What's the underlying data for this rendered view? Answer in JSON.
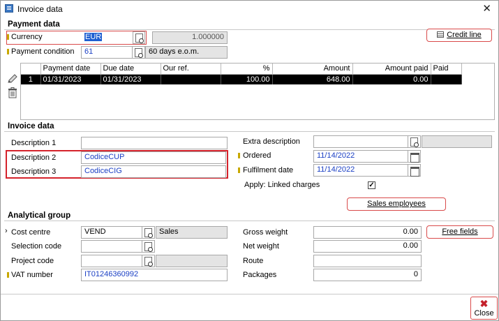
{
  "window": {
    "title": "Invoice data",
    "close_symbol": "✕"
  },
  "payment_data": {
    "section_title": "Payment data",
    "currency_label": "Currency",
    "currency_value": "EUR",
    "exchange_rate": "1.000000",
    "credit_line_label": "Credit line",
    "payment_condition_label": "Payment condition",
    "payment_condition_code": "61",
    "payment_condition_desc": "60 days e.o.m."
  },
  "payments_grid": {
    "columns": [
      "",
      "Payment date",
      "Due date",
      "Our ref.",
      "%",
      "Amount",
      "Amount paid",
      "Paid"
    ],
    "rows": [
      [
        "1",
        "01/31/2023",
        "01/31/2023",
        "",
        "100.00",
        "648.00",
        "0.00",
        ""
      ]
    ]
  },
  "invoice_data": {
    "section_title": "Invoice data",
    "description1_label": "Description 1",
    "description1_value": "",
    "description2_label": "Description 2",
    "description2_value": "CodiceCUP",
    "description3_label": "Description 3",
    "description3_value": "CodiceCIG",
    "extra_description_label": "Extra description",
    "extra_description_value": "",
    "ordered_label": "Ordered",
    "ordered_value": "11/14/2022",
    "fulfilment_label": "Fulfilment date",
    "fulfilment_value": "11/14/2022",
    "linked_charges_label": "Apply: Linked charges",
    "linked_charges_checked": "✓",
    "sales_employees_label": "Sales employees"
  },
  "analytical_group": {
    "section_title": "Analytical group",
    "cost_centre_label": "Cost centre",
    "cost_centre_code": "VEND",
    "cost_centre_desc": "Sales",
    "selection_code_label": "Selection code",
    "project_code_label": "Project code",
    "vat_number_label": "VAT number",
    "vat_number_value": "IT01246360992",
    "gross_weight_label": "Gross weight",
    "gross_weight_value": "0.00",
    "net_weight_label": "Net weight",
    "net_weight_value": "0.00",
    "route_label": "Route",
    "route_value": "",
    "packages_label": "Packages",
    "packages_value": "0",
    "free_fields_label": "Free fields"
  },
  "footer": {
    "close_label": "Close",
    "close_symbol": "✖"
  },
  "colors": {
    "accent_red": "#d5222b",
    "link_blue": "#1a3fc4",
    "required_marker": "#c8a800",
    "grid_yellow": "#f2d21c"
  }
}
